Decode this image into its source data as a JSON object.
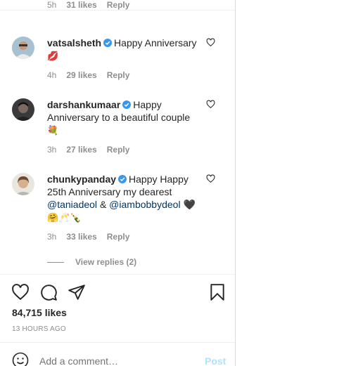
{
  "top_meta": {
    "time": "5h",
    "likes": "31 likes",
    "reply": "Reply"
  },
  "comments": [
    {
      "username": "vatsalsheth",
      "text": "Happy Anniversary",
      "emojis": "💋",
      "time": "4h",
      "likes": "29 likes",
      "reply": "Reply"
    },
    {
      "username": "darshankumaar",
      "text_line1": "Happy",
      "text_rest": "Anniversary to a beautiful couple",
      "emojis": "💐",
      "time": "3h",
      "likes": "27 likes",
      "reply": "Reply"
    },
    {
      "username": "chunkypanday",
      "text_line1": "Happy Happy",
      "text_line2": "25th Anniversary my dearest",
      "mention1": "@taniadeol",
      "amp": "&",
      "mention2": "@iambobbydeol",
      "heart_emoji": "🖤",
      "emojis": "🤗🥂🍾",
      "time": "3h",
      "likes": "33 likes",
      "reply": "Reply",
      "view_replies": "View replies (2)"
    }
  ],
  "post": {
    "likes": "84,715 likes",
    "time_ago": "13 HOURS AGO"
  },
  "comment_bar": {
    "placeholder": "Add a comment…",
    "post_label": "Post"
  },
  "colors": {
    "verified": "#3897f0",
    "mention": "#00376b",
    "muted": "#8e8e8e",
    "post_disabled": "#b2dffc"
  }
}
